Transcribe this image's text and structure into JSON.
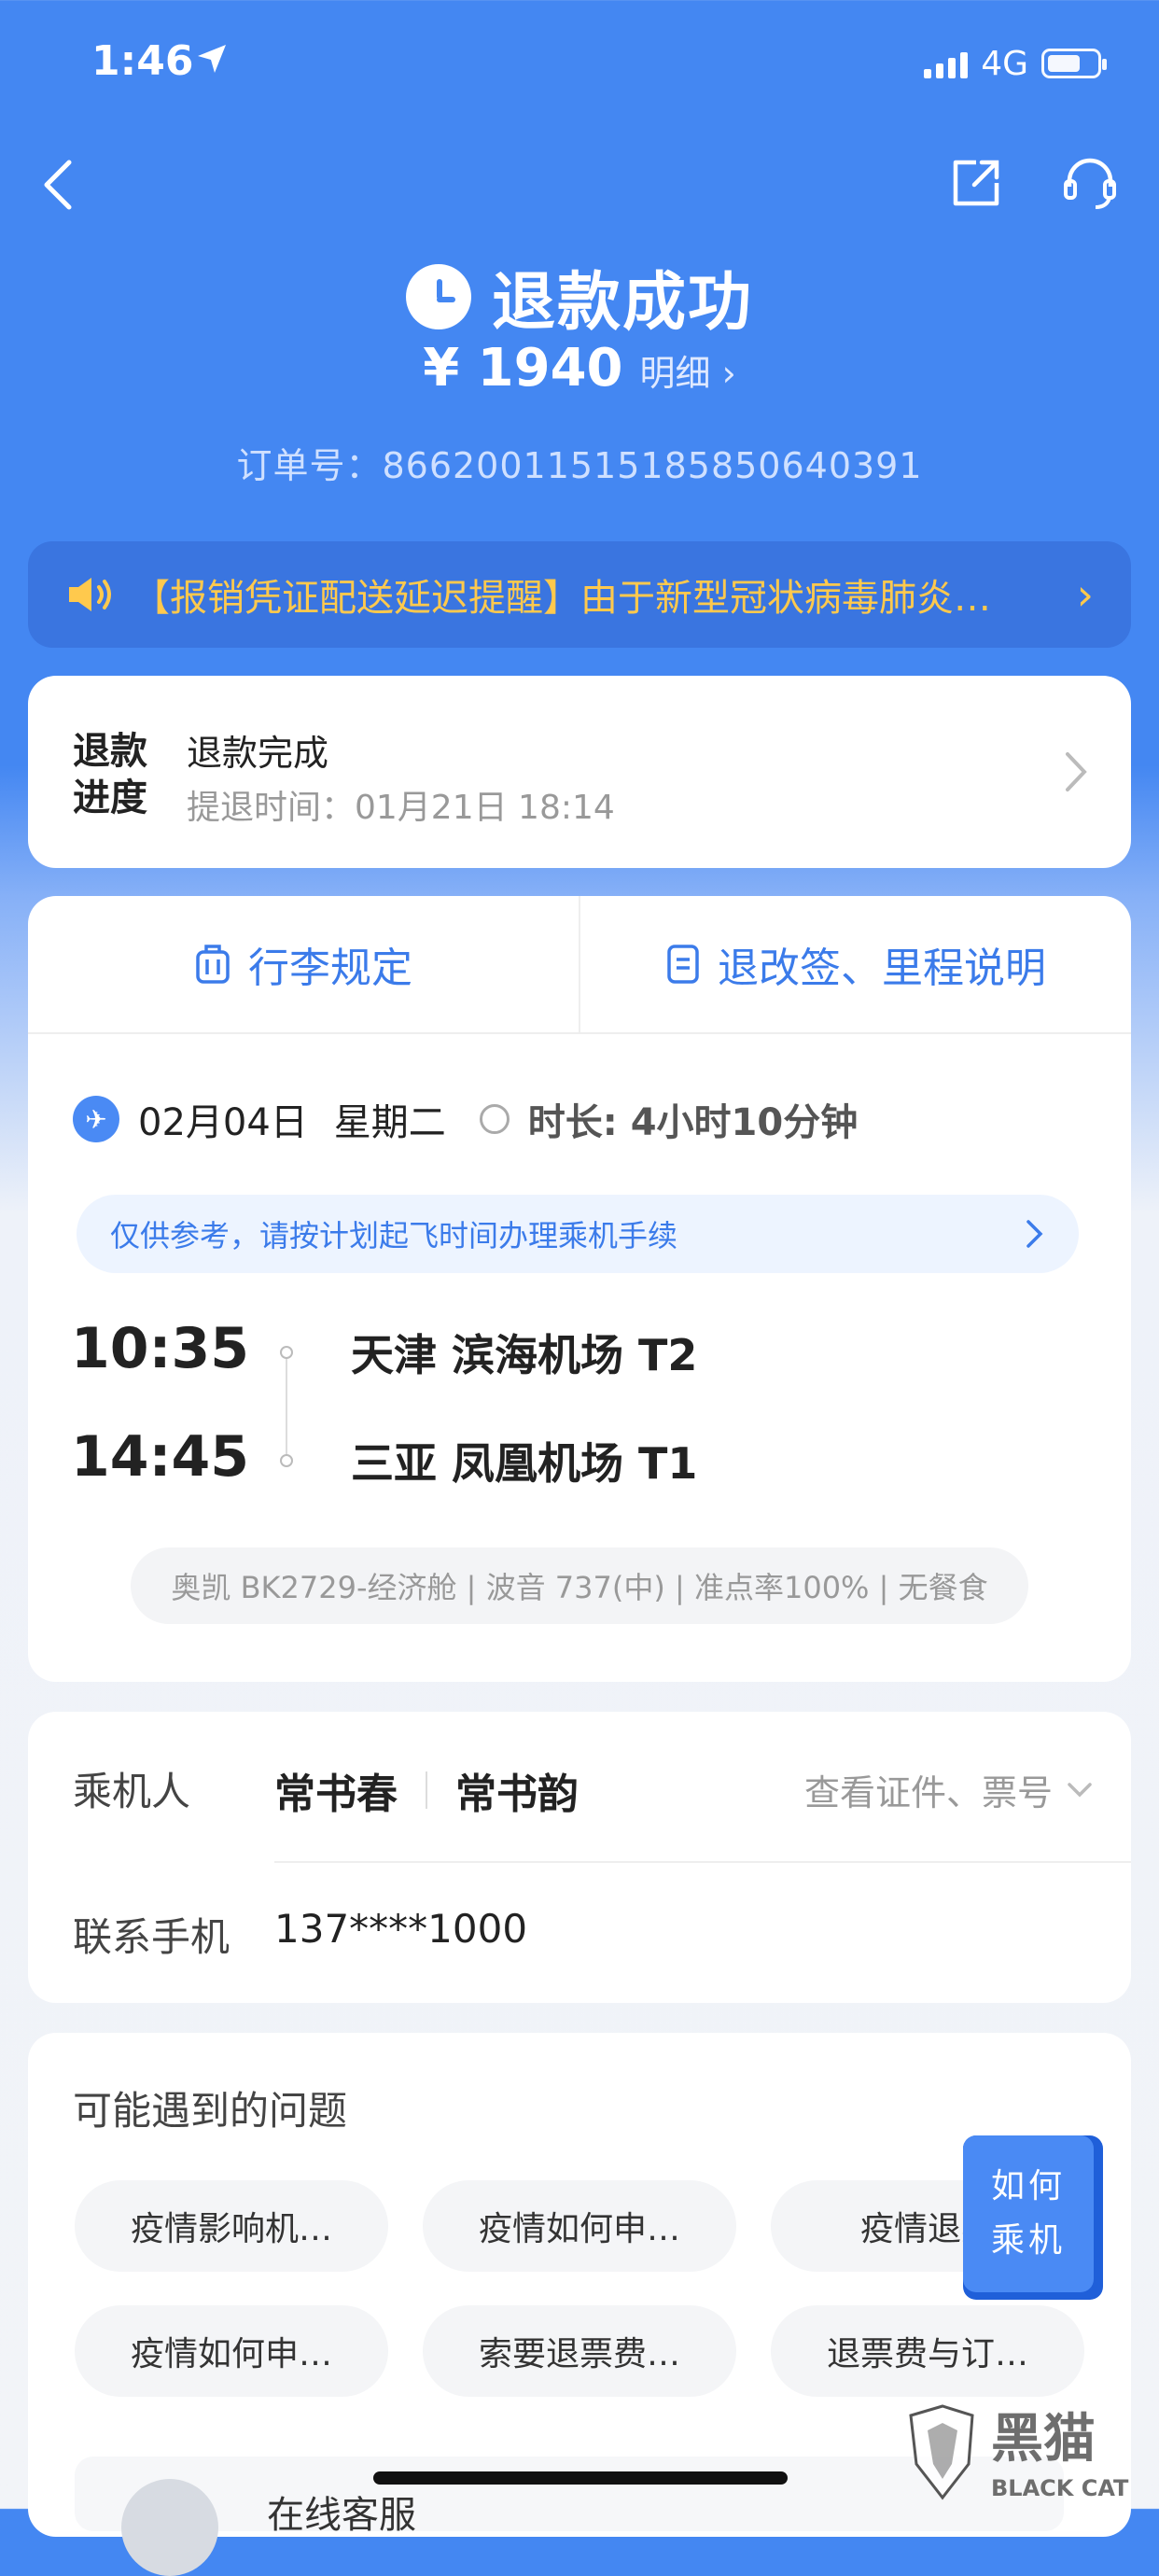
{
  "status": {
    "time": "1:46",
    "network": "4G"
  },
  "header": {
    "title": "退款成功",
    "amount": "¥ 1940",
    "detail_label": "明细 ›",
    "order_label": "订单号：",
    "order_no": "86620011515185850640391"
  },
  "notice": {
    "text": "【报销凭证配送延迟提醒】由于新型冠状病毒肺炎…"
  },
  "progress": {
    "label_line1": "退款",
    "label_line2": "进度",
    "status": "退款完成",
    "time_text": "提退时间：01月21日 18:14"
  },
  "tabs": [
    {
      "label": "行李规定"
    },
    {
      "label": "退改签、里程说明"
    }
  ],
  "flight": {
    "date": "02月04日",
    "weekday": "星期二",
    "duration": "时长: 4小时10分钟",
    "hint": "仅供参考，请按计划起飞时间办理乘机手续",
    "dep_time": "10:35",
    "dep_airport": "天津 滨海机场 T2",
    "arr_time": "14:45",
    "arr_airport": "三亚 凤凰机场 T1",
    "info": "奥凯 BK2729-经济舱 | 波音 737(中) | 准点率100% | 无餐食"
  },
  "passenger": {
    "label": "乘机人",
    "names": [
      "常书春",
      "常书韵"
    ],
    "id_link": "查看证件、票号",
    "phone_label": "联系手机",
    "phone": "137****1000"
  },
  "faq": {
    "title": "可能遇到的问题",
    "chips": [
      "疫情影响机…",
      "疫情如何申…",
      "疫情退票",
      "疫情如何申…",
      "索要退票费…",
      "退票费与订…"
    ]
  },
  "float_button": {
    "line1": "如何",
    "line2": "乘机"
  },
  "service": {
    "label": "在线客服"
  },
  "watermark": {
    "text": "黑猫",
    "sub": "BLACK CAT"
  },
  "colors": {
    "primary": "#4487f2",
    "notice_text": "#ffc94d",
    "link": "#3b7bea"
  }
}
